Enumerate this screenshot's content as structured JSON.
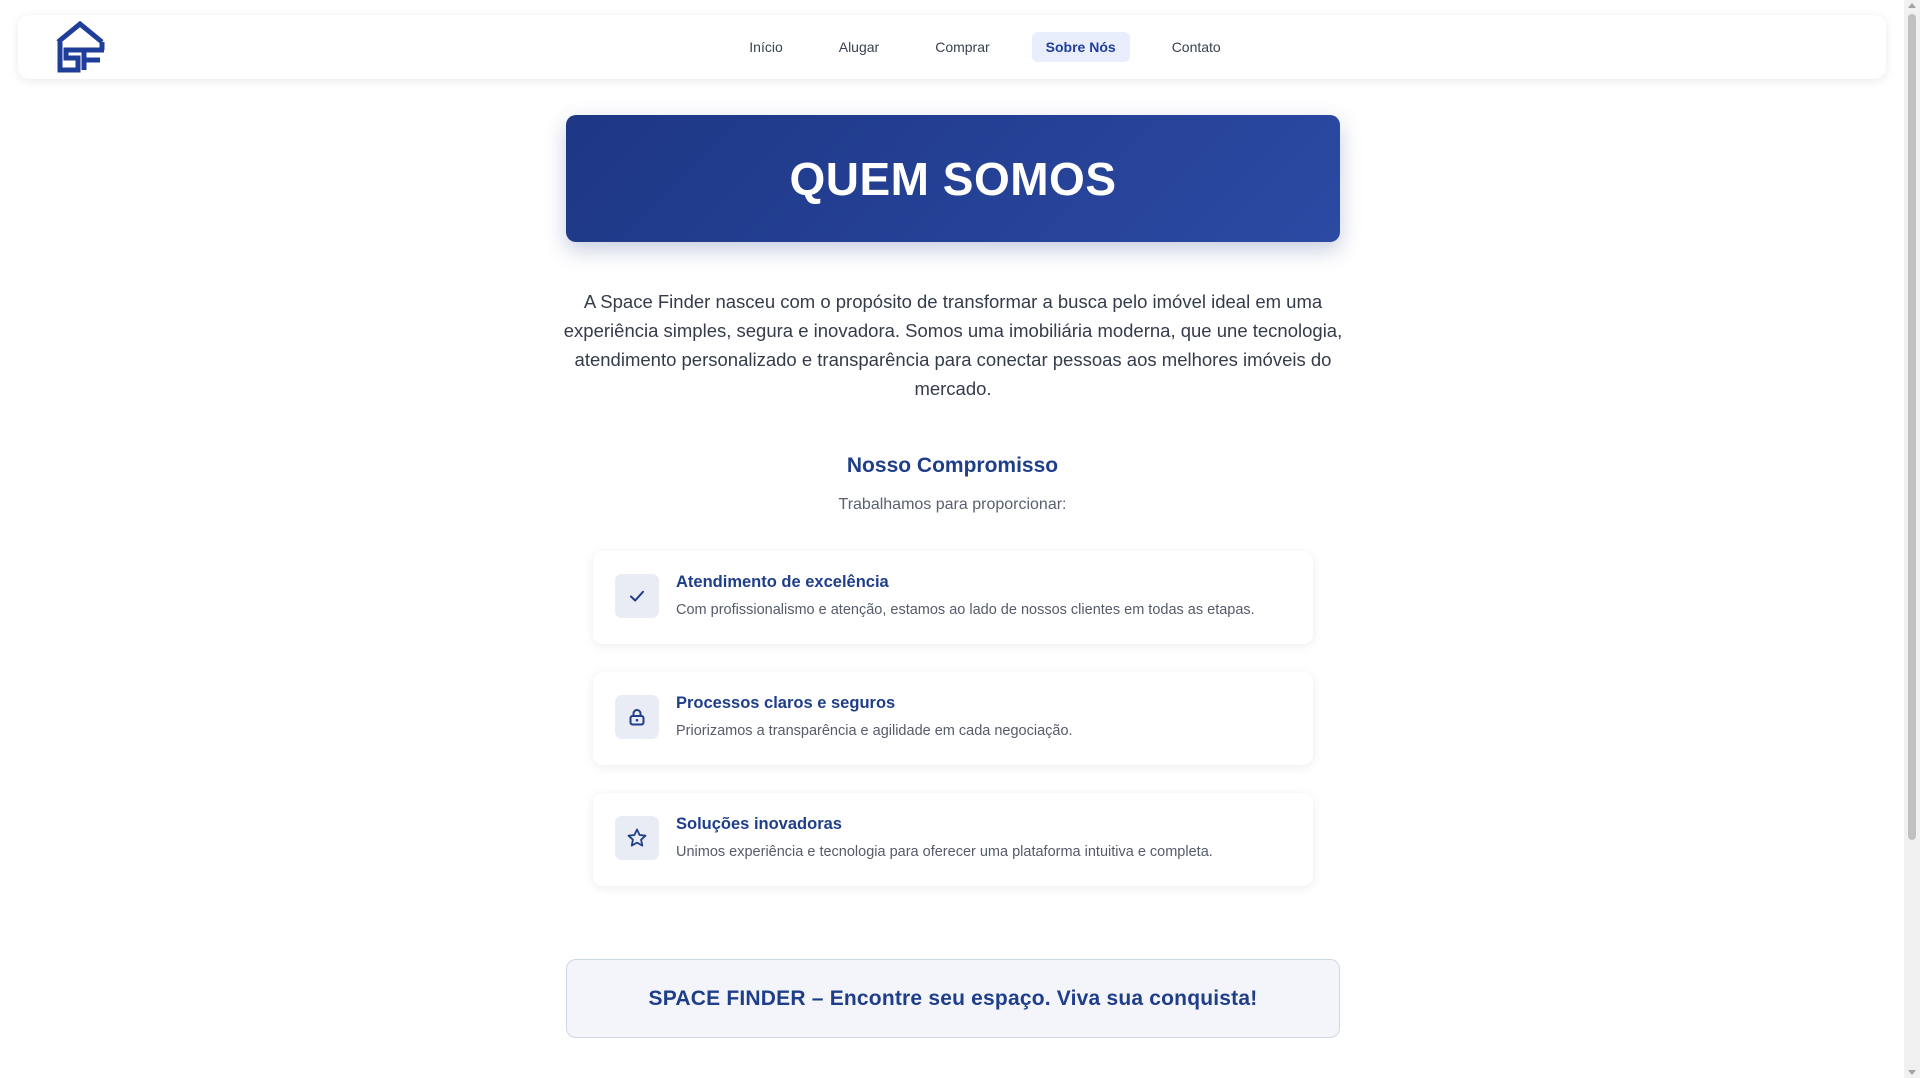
{
  "nav": {
    "logo_icon": "space-finder-logo",
    "links": [
      {
        "label": "Início"
      },
      {
        "label": "Alugar"
      },
      {
        "label": "Comprar"
      },
      {
        "label": "Sobre Nós",
        "active": true
      },
      {
        "label": "Contato"
      }
    ]
  },
  "hero": {
    "title": "QUEM SOMOS"
  },
  "intro": "A Space Finder nasceu com o propósito de transformar a busca pelo imóvel ideal em uma experiência simples, segura e inovadora. Somos uma imobiliária moderna, que une tecnologia, atendimento personalizado e transparência para conectar pessoas aos melhores imóveis do mercado.",
  "commitment": {
    "title": "Nosso Compromisso",
    "subtitle": "Trabalhamos para proporcionar:",
    "items": [
      {
        "icon": "check-icon",
        "title": "Atendimento de excelência",
        "text": "Com profissionalismo e atenção, estamos ao lado de nossos clientes em todas as etapas."
      },
      {
        "icon": "lock-icon",
        "title": "Processos claros e seguros",
        "text": "Priorizamos a transparência e agilidade em cada negociação."
      },
      {
        "icon": "star-icon",
        "title": "Soluções inovadoras",
        "text": "Unimos experiência e tecnologia para oferecer uma plataforma intuitiva e completa."
      }
    ]
  },
  "footer_banner": "SPACE FINDER – Encontre seu espaço. Viva sua conquista!",
  "colors": {
    "primary": "#1f3e8a",
    "hero_start": "#1e3785",
    "hero_end": "#2b4aa3",
    "active_nav_bg": "#e8eefb"
  }
}
